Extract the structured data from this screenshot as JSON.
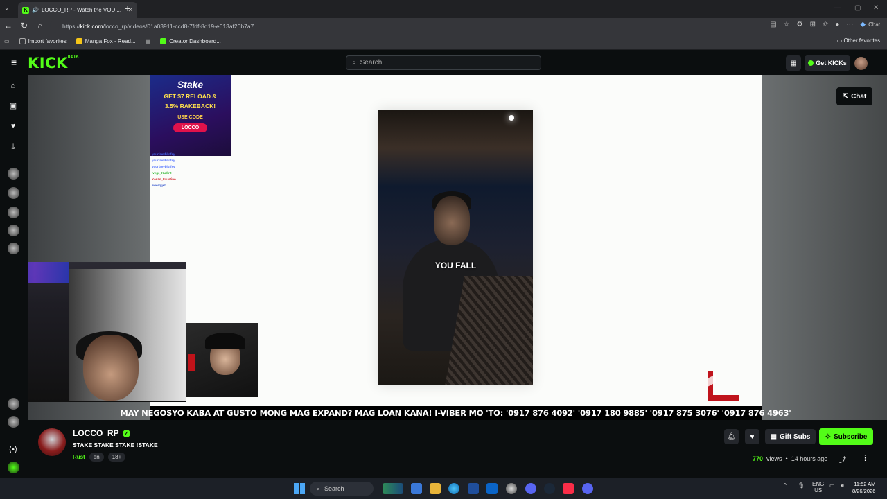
{
  "browser": {
    "tab_title": "LOCCO_RP - Watch the VOD ...",
    "tab_favicon_letter": "K",
    "url_prefix": "https://",
    "url_host": "kick.com",
    "url_path": "/locco_rp/videos/01a03911-ccd8-7fdf-8d19-e613af20b7a7",
    "chat_button": "Chat",
    "bookmarks": [
      {
        "label": "Import favorites",
        "color": "#5f6368"
      },
      {
        "label": "Manga Fox - Read...",
        "color": "#f5c518"
      },
      {
        "label": "Creator Dashboard...",
        "color": "#53fc18"
      }
    ],
    "other_favorites": "Other favorites"
  },
  "kick": {
    "logo": "KICK",
    "logo_badge": "BETA",
    "search_placeholder": "Search",
    "get_kicks": "Get KICKs",
    "chat_toggle": "Chat",
    "accent": "#53fc18"
  },
  "video": {
    "ad": {
      "brand": "Stake",
      "headline_1": "GET $7 RELOAD &",
      "headline_2": "3.5% RAKEBACK!",
      "use_code": "USE CODE",
      "code": "LOCCO"
    },
    "overlay_chat": [
      {
        "user": "yourfavvbluffsy",
        "msg": "",
        "color": "#4a6cff"
      },
      {
        "user": "yourfavvbluffsy",
        "msg": "",
        "color": "#4a6cff"
      },
      {
        "user": "yourfavvbluffsy",
        "msg": "",
        "color": "#4a6cff"
      },
      {
        "user": "Ivege_Kudirit",
        "msg": "",
        "color": "#2db52d"
      },
      {
        "user": "Kenzo_Faustino",
        "msg": "",
        "color": "#d4282f"
      },
      {
        "user": "awerryjet",
        "msg": "",
        "color": "#3355cc"
      }
    ],
    "caption": "YOU FALL",
    "ticker": "MAY NEGOSYO KABA AT GUSTO MONG MAG EXPAND? MAG LOAN KANA! I-VIBER MO 'TO: '0917 876 4092' '0917 180 9885' '0917 875 3076' '0917 876 4963'"
  },
  "channel": {
    "name": "LOCCO_RP",
    "title": "STAKE STAKE STAKE !STAKE",
    "category": "Rust",
    "tags": [
      "en",
      "18+"
    ],
    "gift_subs": "Gift Subs",
    "subscribe": "Subscribe",
    "views": "770",
    "views_label": "views",
    "separator": "•",
    "time_ago": "14 hours ago"
  },
  "taskbar": {
    "search": "Search",
    "lang_1": "ENG",
    "lang_2": "US",
    "time": "11:52 AM",
    "date": "8/26/2026"
  }
}
